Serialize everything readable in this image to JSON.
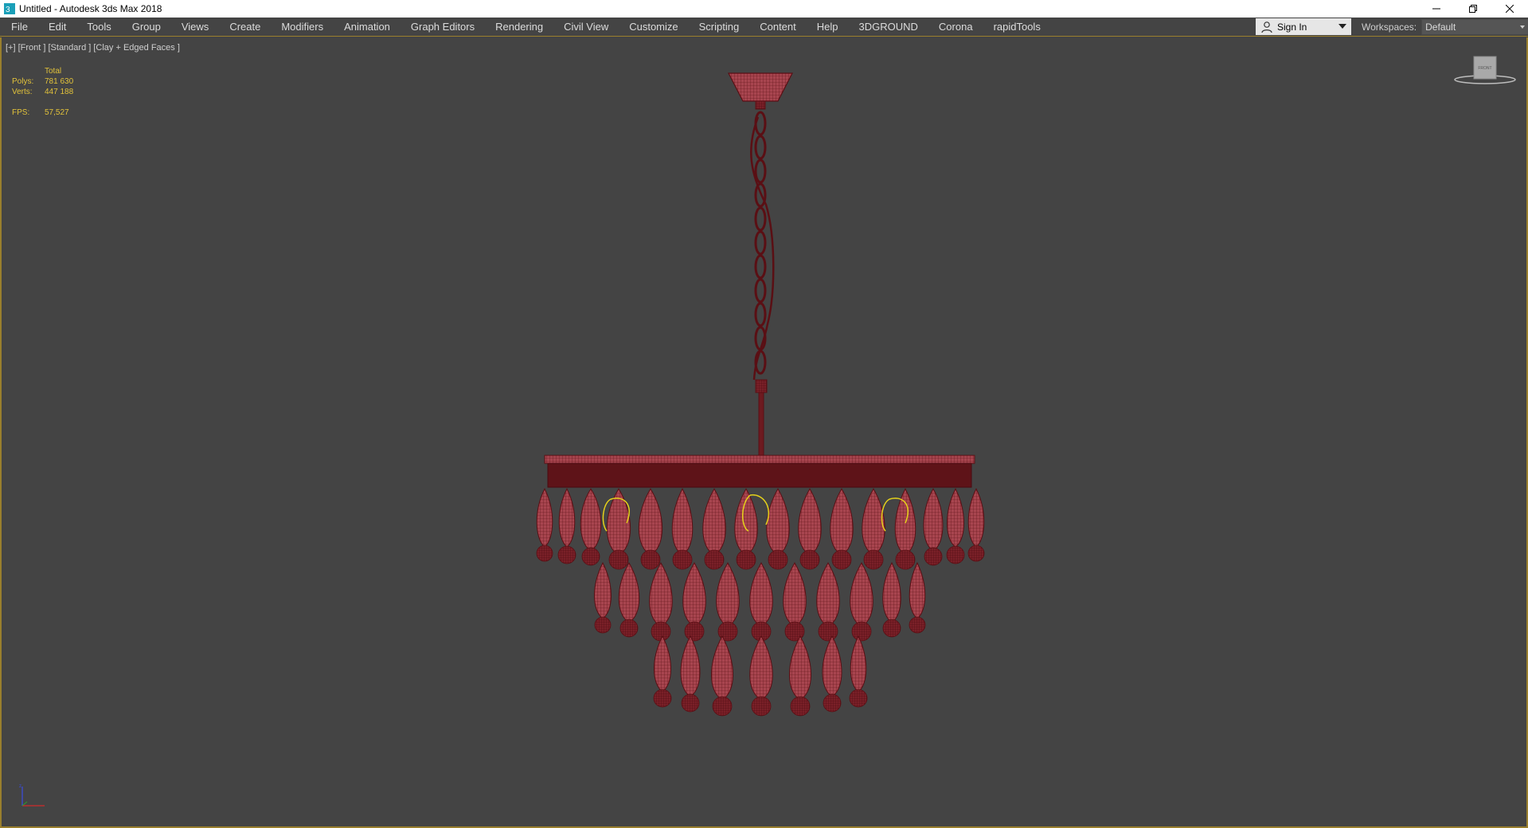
{
  "window": {
    "title": "Untitled - Autodesk 3ds Max 2018",
    "controls": [
      "minimize",
      "restore",
      "close"
    ]
  },
  "menu": {
    "items": [
      "File",
      "Edit",
      "Tools",
      "Group",
      "Views",
      "Create",
      "Modifiers",
      "Animation",
      "Graph Editors",
      "Rendering",
      "Civil View",
      "Customize",
      "Scripting",
      "Content",
      "Help",
      "3DGROUND",
      "Corona",
      "rapidTools"
    ]
  },
  "signin": {
    "label": "Sign In"
  },
  "workspaces": {
    "label": "Workspaces:",
    "value": "Default"
  },
  "viewport": {
    "label": "[+] [Front ] [Standard ] [Clay + Edged Faces ]",
    "stats": {
      "header": "Total",
      "polys_label": "Polys:",
      "polys_value": "781 630",
      "verts_label": "Verts:",
      "verts_value": "447 188",
      "fps_label": "FPS:",
      "fps_value": "57,527"
    },
    "viewcube_face": "FRONT"
  },
  "colors": {
    "viewport_bg": "#444444",
    "active_border": "#9a7f2d",
    "stats_text": "#e2c23a",
    "model_wire": "#5a0f14",
    "model_fill": "#a8454f",
    "selection_highlight": "#e6d21a"
  }
}
